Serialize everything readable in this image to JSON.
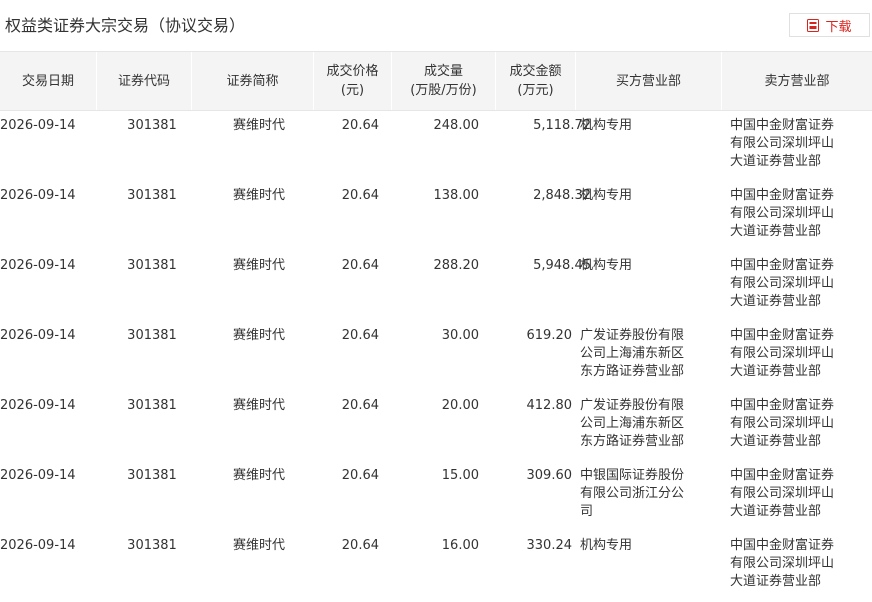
{
  "page": {
    "title": "权益类证券大宗交易（协议交易）",
    "download_label": "下载"
  },
  "colors": {
    "accent": "#d9231d",
    "header_bg": "#f4f4f4",
    "text": "#333333"
  },
  "table": {
    "headers": [
      "交易日期",
      "证券代码",
      "证券简称",
      "成交价格\n(元)",
      "成交量\n(万股/万份)",
      "成交金额\n(万元)",
      "买方营业部",
      "卖方营业部"
    ],
    "rows": [
      [
        "2026-09-14",
        "301381",
        "赛维时代",
        "20.64",
        "248.00",
        "5,118.72",
        "机构专用",
        "中国中金财富证券有限公司深圳坪山大道证券营业部"
      ],
      [
        "2026-09-14",
        "301381",
        "赛维时代",
        "20.64",
        "138.00",
        "2,848.32",
        "机构专用",
        "中国中金财富证券有限公司深圳坪山大道证券营业部"
      ],
      [
        "2026-09-14",
        "301381",
        "赛维时代",
        "20.64",
        "288.20",
        "5,948.45",
        "机构专用",
        "中国中金财富证券有限公司深圳坪山大道证券营业部"
      ],
      [
        "2026-09-14",
        "301381",
        "赛维时代",
        "20.64",
        "30.00",
        "619.20",
        "广发证券股份有限公司上海浦东新区东方路证券营业部",
        "中国中金财富证券有限公司深圳坪山大道证券营业部"
      ],
      [
        "2026-09-14",
        "301381",
        "赛维时代",
        "20.64",
        "20.00",
        "412.80",
        "广发证券股份有限公司上海浦东新区东方路证券营业部",
        "中国中金财富证券有限公司深圳坪山大道证券营业部"
      ],
      [
        "2026-09-14",
        "301381",
        "赛维时代",
        "20.64",
        "15.00",
        "309.60",
        "中银国际证券股份有限公司浙江分公司",
        "中国中金财富证券有限公司深圳坪山大道证券营业部"
      ],
      [
        "2026-09-14",
        "301381",
        "赛维时代",
        "20.64",
        "16.00",
        "330.24",
        "机构专用",
        "中国中金财富证券有限公司深圳坪山大道证券营业部"
      ]
    ]
  }
}
